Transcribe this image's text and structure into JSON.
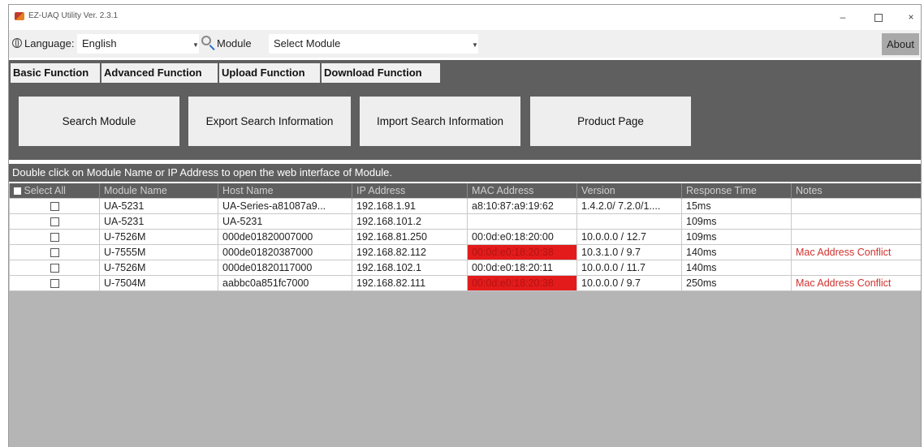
{
  "window": {
    "title": "EZ-UAQ Utility Ver. 2.3.1",
    "controls": {
      "minimize": "–",
      "close": "×"
    }
  },
  "selector_bar": {
    "language_label": "Language:",
    "language_value": "English",
    "module_label": "Module",
    "module_value": "Select Module",
    "about_label": "About"
  },
  "tabs": [
    {
      "label": "Basic Function",
      "active": true
    },
    {
      "label": "Advanced Function",
      "active": false
    },
    {
      "label": "Upload Function",
      "active": false
    },
    {
      "label": "Download Function",
      "active": false
    }
  ],
  "toolbar": {
    "buttons": [
      {
        "label": "Search Module"
      },
      {
        "label": "Export Search Information"
      },
      {
        "label": "Import Search Information"
      },
      {
        "label": "Product Page"
      }
    ]
  },
  "hint": "Double click on Module Name or IP Address to open the web interface of Module.",
  "table": {
    "columns": [
      "Select All",
      "Module Name",
      "Host Name",
      "IP Address",
      "MAC Address",
      "Version",
      "Response Time",
      "Notes"
    ],
    "rows": [
      {
        "module": "UA-5231",
        "host": "UA-Series-a81087a9...",
        "ip": "192.168.1.91",
        "mac": "a8:10:87:a9:19:62",
        "version": "1.4.2.0/ 7.2.0/1....",
        "response": "15ms",
        "notes": ""
      },
      {
        "module": "UA-5231",
        "host": "UA-5231",
        "ip": "192.168.101.2",
        "mac": "",
        "version": "",
        "response": "109ms",
        "notes": ""
      },
      {
        "module": "U-7526M",
        "host": "000de01820007000",
        "ip": "192.168.81.250",
        "mac": "00:0d:e0:18:20:00",
        "version": "10.0.0.0 / 12.7",
        "response": "109ms",
        "notes": ""
      },
      {
        "module": "U-7555M",
        "host": "000de01820387000",
        "ip": "192.168.82.112",
        "mac": "00:0d:e0:18:20:38",
        "version": "10.3.1.0 / 9.7",
        "response": "140ms",
        "notes": "Mac Address Conflict"
      },
      {
        "module": "U-7526M",
        "host": "000de01820117000",
        "ip": "192.168.102.1",
        "mac": "00:0d:e0:18:20:11",
        "version": "10.0.0.0 / 11.7",
        "response": "140ms",
        "notes": ""
      },
      {
        "module": "U-7504M",
        "host": "aabbc0a851fc7000",
        "ip": "192.168.82.111",
        "mac": "00:0d:e0:18:20:38",
        "version": "10.0.0.0 / 9.7",
        "response": "250ms",
        "notes": "Mac Address Conflict"
      }
    ]
  },
  "colors": {
    "panel_gray": "#5f5f5f",
    "conflict_red": "#e31b1b",
    "note_red": "#d0312d"
  }
}
